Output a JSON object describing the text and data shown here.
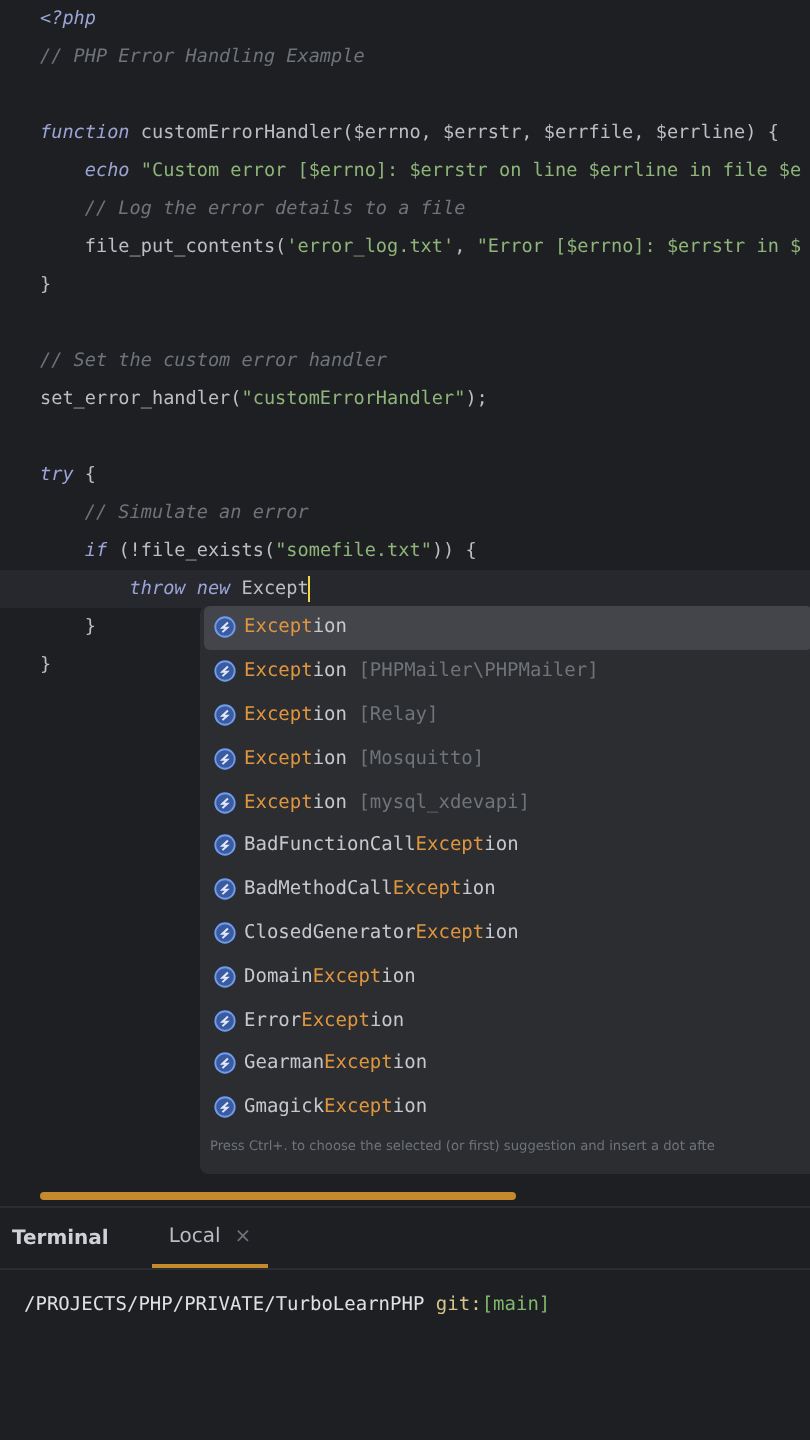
{
  "editor": {
    "blocks": [
      {
        "lines": [
          {
            "tokens": [
              {
                "kind": "keyword",
                "text": "<?php"
              }
            ]
          },
          {
            "tokens": [
              {
                "kind": "comment",
                "text": "// PHP Error Handling Example"
              }
            ]
          }
        ]
      },
      {
        "lines": [
          {
            "tokens": [
              {
                "kind": "keyword",
                "text": "function"
              },
              {
                "kind": "plain",
                "text": " customErrorHandler($errno, $errstr, $errfile, $errline) {"
              }
            ]
          },
          {
            "tokens": [
              {
                "kind": "keyword",
                "text": "    echo"
              },
              {
                "kind": "string",
                "text": " \"Custom error [$errno]: $errstr on line $errline in file $e"
              }
            ]
          },
          {
            "tokens": [
              {
                "kind": "comment",
                "text": "    // Log the error details to a file"
              }
            ]
          },
          {
            "tokens": [
              {
                "kind": "plain",
                "text": "    file_put_contents("
              },
              {
                "kind": "string",
                "text": "'error_log.txt'"
              },
              {
                "kind": "plain",
                "text": ", "
              },
              {
                "kind": "string",
                "text": "\"Error [$errno]: $errstr in $"
              }
            ]
          },
          {
            "tokens": [
              {
                "kind": "plain",
                "text": "}"
              }
            ]
          }
        ]
      },
      {
        "lines": [
          {
            "tokens": [
              {
                "kind": "comment",
                "text": "// Set the custom error handler"
              }
            ]
          },
          {
            "tokens": [
              {
                "kind": "plain",
                "text": "set_error_handler("
              },
              {
                "kind": "string",
                "text": "\"customErrorHandler\""
              },
              {
                "kind": "plain",
                "text": ");"
              }
            ]
          }
        ]
      },
      {
        "lines": [
          {
            "tokens": [
              {
                "kind": "keyword",
                "text": "try"
              },
              {
                "kind": "plain",
                "text": " {"
              }
            ]
          },
          {
            "tokens": [
              {
                "kind": "comment",
                "text": "    // Simulate an error"
              }
            ]
          },
          {
            "tokens": [
              {
                "kind": "keyword",
                "text": "    if"
              },
              {
                "kind": "plain",
                "text": " (!file_exists("
              },
              {
                "kind": "string",
                "text": "\"somefile.txt\""
              },
              {
                "kind": "plain",
                "text": ")) {"
              }
            ]
          },
          {
            "current": true,
            "tokens": [
              {
                "kind": "keyword",
                "text": "        throw new"
              },
              {
                "kind": "plain",
                "text": " Except"
              }
            ]
          },
          {
            "tokens": [
              {
                "kind": "plain",
                "text": "    }"
              }
            ]
          },
          {
            "tokens": [
              {
                "kind": "plain",
                "text": "}"
              }
            ]
          }
        ]
      }
    ]
  },
  "completion": {
    "items": [
      {
        "selected": true,
        "match": "Except",
        "after": "ion"
      },
      {
        "selected": false,
        "match": "Except",
        "after": "ion",
        "namespace": "[PHPMailer\\PHPMailer]"
      },
      {
        "selected": false,
        "match": "Except",
        "after": "ion",
        "namespace": "[Relay]"
      },
      {
        "selected": false,
        "match": "Except",
        "after": "ion",
        "namespace": "[Mosquitto]"
      },
      {
        "selected": false,
        "match": "Except",
        "after": "ion",
        "namespace": "[mysql_xdevapi]"
      },
      {
        "selected": false,
        "before": "BadFunctionCall",
        "match": "Except",
        "after": "ion"
      },
      {
        "selected": false,
        "before": "BadMethodCall",
        "match": "Except",
        "after": "ion"
      },
      {
        "selected": false,
        "before": "ClosedGenerator",
        "match": "Except",
        "after": "ion"
      },
      {
        "selected": false,
        "before": "Domain",
        "match": "Except",
        "after": "ion"
      },
      {
        "selected": false,
        "before": "Error",
        "match": "Except",
        "after": "ion"
      },
      {
        "selected": false,
        "before": "Gearman",
        "match": "Except",
        "after": "ion"
      },
      {
        "selected": false,
        "before": "Gmagick",
        "match": "Except",
        "after": "ion"
      }
    ],
    "hint": "Press Ctrl+. to choose the selected (or first) suggestion and insert a dot afte"
  },
  "terminal": {
    "title": "Terminal",
    "tabs": [
      {
        "label": "Local",
        "selected": true,
        "close": "×"
      }
    ],
    "prompt": {
      "path": "/PROJECTS/PHP/PRIVATE/TurboLearnPHP",
      "git": "git:",
      "branch": "[main]"
    }
  }
}
